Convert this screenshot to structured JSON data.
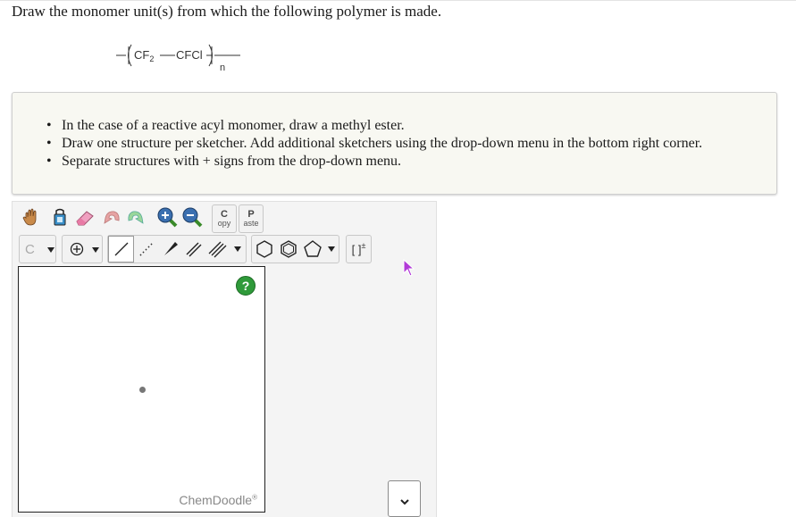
{
  "question": "Draw the monomer unit(s) from which the following polymer is made.",
  "polymer": {
    "left_unit": "CF",
    "left_subscript": "2",
    "right_unit": "CFCl",
    "repeat": "n"
  },
  "instructions": [
    "In the case of a reactive acyl monomer, draw a methyl ester.",
    "Draw one structure per sketcher. Add additional sketchers using the drop-down menu in the bottom right corner.",
    "Separate structures with + signs from the drop-down menu."
  ],
  "toolbar": {
    "copy_big": "C",
    "copy_small": "opy",
    "paste_big": "P",
    "paste_small": "aste",
    "atom_label": "C",
    "bracket_label": "[ ]",
    "bracket_sup": "±"
  },
  "canvas": {
    "help_label": "?",
    "watermark": "ChemDoodle",
    "watermark_mark": "®"
  },
  "colors": {
    "help_green": "#2f9a3a",
    "cursor": "#b23ad8"
  }
}
